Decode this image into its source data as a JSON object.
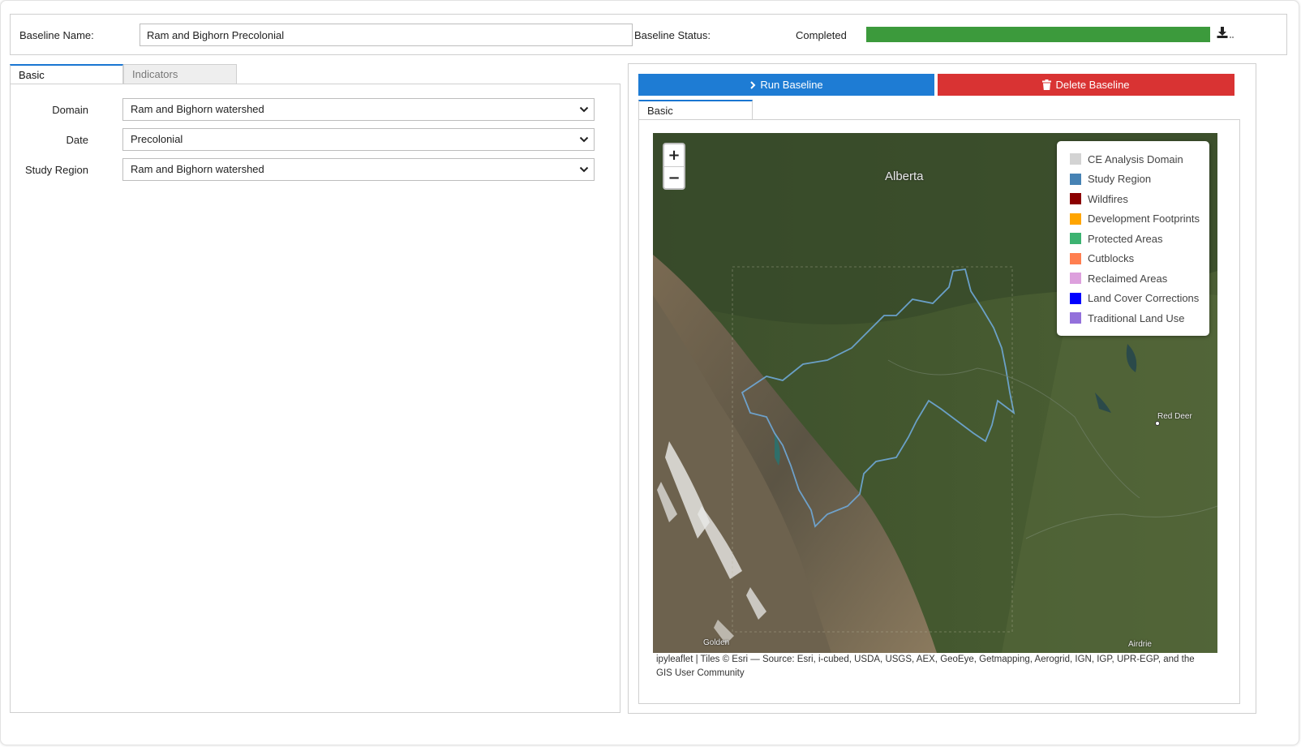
{
  "header": {
    "name_label": "Baseline Name:",
    "name_value": "Ram and Bighorn Precolonial",
    "status_label": "Baseline Status:",
    "status_text": "Completed",
    "status_progress": 1.0,
    "status_color": "#3c9a3c",
    "download_icon": "download-icon"
  },
  "left": {
    "tabs": [
      {
        "label": "Basic",
        "active": true
      },
      {
        "label": "Indicators",
        "active": false
      }
    ],
    "fields": [
      {
        "label": "Domain",
        "value": "Ram and Bighorn watershed"
      },
      {
        "label": "Date",
        "value": "Precolonial"
      },
      {
        "label": "Study Region",
        "value": "Ram and Bighorn watershed"
      }
    ]
  },
  "right": {
    "run_button": {
      "label": "Run Baseline",
      "icon": "chevron-right-icon",
      "color": "#1e7cd4"
    },
    "delete_button": {
      "label": "Delete Baseline",
      "icon": "trash-icon",
      "color": "#d93333"
    },
    "tab": "Basic"
  },
  "map": {
    "zoom_in": "+",
    "zoom_out": "−",
    "region_label": "Alberta",
    "place_labels": {
      "red_deer": "Red Deer",
      "golden": "Golden",
      "airdrie": "Airdrie"
    },
    "legend": [
      {
        "label": "CE Analysis Domain",
        "color": "#d3d3d3"
      },
      {
        "label": "Study Region",
        "color": "#4682b4"
      },
      {
        "label": "Wildfires",
        "color": "#8b0000"
      },
      {
        "label": "Development Footprints",
        "color": "#ffa500"
      },
      {
        "label": "Protected Areas",
        "color": "#3cb371"
      },
      {
        "label": "Cutblocks",
        "color": "#ff7f50"
      },
      {
        "label": "Reclaimed Areas",
        "color": "#dda0dd"
      },
      {
        "label": "Land Cover Corrections",
        "color": "#0000ff"
      },
      {
        "label": "Traditional Land Use",
        "color": "#9370db"
      }
    ],
    "attribution_line1": "ipyleaflet | Tiles © Esri — Source: Esri, i-cubed, USDA, USGS, AEX, GeoEye, Getmapping, Aerogrid, IGN, IGP, UPR-EGP, and the",
    "attribution_line2": "GIS User Community"
  }
}
